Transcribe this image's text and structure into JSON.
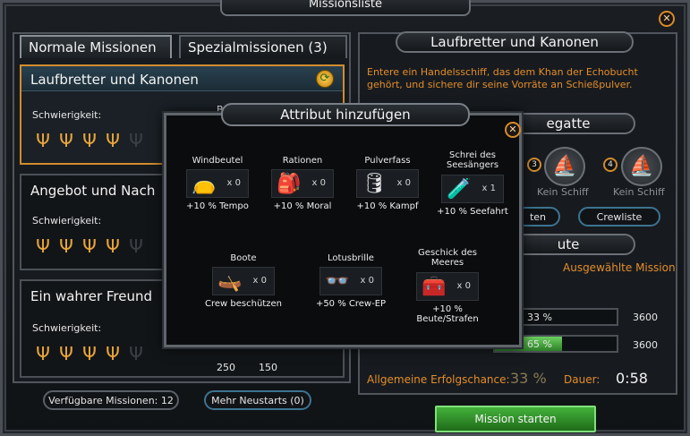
{
  "window": {
    "title": "Missionsliste"
  },
  "tabs": [
    {
      "label": "Normale Missionen",
      "active": true
    },
    {
      "label": "Spezialmissionen (3)",
      "active": false
    }
  ],
  "missions": [
    {
      "title": "Laufbretter und Kanonen",
      "difficulty_label": "Schwierigkeit:",
      "difficulty": 4,
      "max": 5,
      "selected": true,
      "extra": "B"
    },
    {
      "title": "Angebot und Nach",
      "difficulty_label": "Schwierigkeit:",
      "difficulty": 4,
      "max": 5,
      "selected": false
    },
    {
      "title": "Ein wahrer Freund",
      "difficulty_label": "Schwierigkeit:",
      "difficulty": 4,
      "max": 5,
      "selected": false
    }
  ],
  "rewards_partial": {
    "gold": "250",
    "other": "150"
  },
  "left_footer": {
    "available": "Verfügbare Missionen: 12",
    "restarts": "Mehr Neustarts (0)"
  },
  "detail": {
    "title": "Laufbretter und Kanonen",
    "description": "Entere ein Handelsschiff, das dem Khan der Echobucht gehört, und sichere dir seine Vorräte an Schießpulver.",
    "fleet_heading_partial": "egatte",
    "ships": [
      {
        "num": "3",
        "label": "Kein Schiff"
      },
      {
        "num": "4",
        "label": "Kein Schiff"
      }
    ],
    "crew_button_partial": "ten",
    "crew_list_button": "Crewliste",
    "loot_heading_partial": "ute",
    "selected_mission_label": "Ausgewählte Mission",
    "progress": [
      {
        "text": "33 %",
        "value": 0.33,
        "amount": "3600"
      },
      {
        "text": "65 %",
        "value": 0.65,
        "amount": "3600"
      }
    ],
    "success_label": "Allgemeine Erfolgschance:",
    "success_value": "33 %",
    "duration_label": "Dauer:",
    "duration_value": "0:58",
    "start_button": "Mission starten"
  },
  "modal": {
    "title": "Attribut hinzufügen",
    "attributes": [
      {
        "name": "Windbeutel",
        "icon": "pouch-icon",
        "glyph": "👝",
        "count": "x 0",
        "bonus": "+10 % Tempo"
      },
      {
        "name": "Rationen",
        "icon": "backpack-icon",
        "glyph": "🎒",
        "count": "x 0",
        "bonus": "+10 % Moral"
      },
      {
        "name": "Pulverfass",
        "icon": "barrel-icon",
        "glyph": "🛢",
        "count": "x 0",
        "bonus": "+10 % Kampf"
      },
      {
        "name": "Schrei des Seesängers",
        "icon": "bottle-icon",
        "glyph": "🧪",
        "count": "x 1",
        "bonus": "+10 % Seefahrt"
      },
      {
        "name": "Boote",
        "icon": "boat-icon",
        "glyph": "🛶",
        "count": "x 0",
        "bonus": "Crew beschützen"
      },
      {
        "name": "Lotusbrille",
        "icon": "goggles-icon",
        "glyph": "👓",
        "count": "x 0",
        "bonus": "+50 % Crew-EP"
      },
      {
        "name": "Geschick des Meeres",
        "icon": "chest-icon",
        "glyph": "🧰",
        "count": "x 0",
        "bonus": "+10 % Beute/Strafen"
      }
    ]
  },
  "colors": {
    "accent_orange": "#e48d2c",
    "progress_green": "#3aa532",
    "selected_border": "#d28c2e"
  }
}
